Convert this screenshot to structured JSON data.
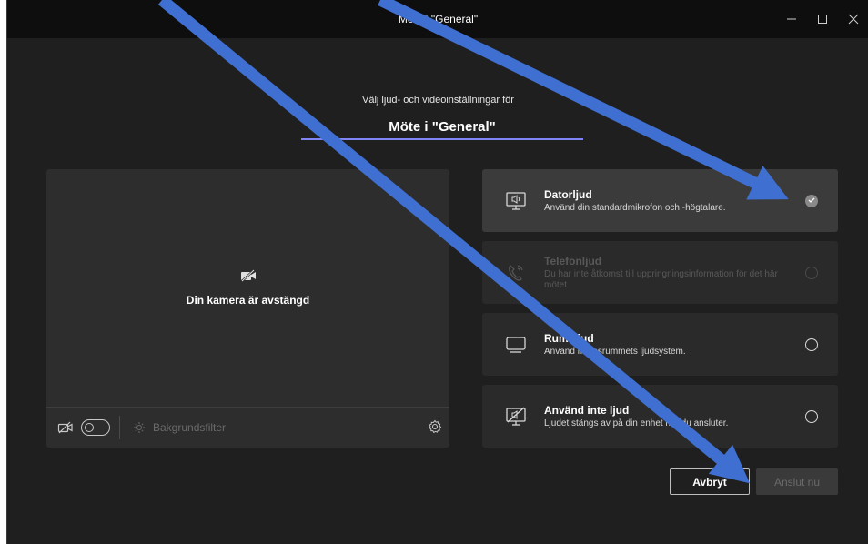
{
  "window": {
    "title": "Möte i \"General\"",
    "controls": [
      "minimize",
      "maximize",
      "close"
    ]
  },
  "prompt": "Välj ljud- och videoinställningar för",
  "meeting_name": "Möte i \"General\"",
  "preview": {
    "camera_off_text": "Din kamera är avstängd",
    "background_filter_label": "Bakgrundsfilter"
  },
  "audio_options": [
    {
      "title": "Datorljud",
      "desc": "Använd din standardmikrofon och -högtalare.",
      "state": "selected"
    },
    {
      "title": "Telefonljud",
      "desc": "Du har inte åtkomst till uppringningsinformation för det här mötet",
      "state": "disabled"
    },
    {
      "title": "Rumsljud",
      "desc": "Använd mötesrummets ljudsystem.",
      "state": "unselected"
    },
    {
      "title": "Använd inte ljud",
      "desc": "Ljudet stängs av på din enhet när du ansluter.",
      "state": "unselected"
    }
  ],
  "buttons": {
    "cancel": "Avbryt",
    "join": "Anslut nu"
  },
  "colors": {
    "accent": "#7f85f5",
    "annotation_arrow": "#3f6fd1"
  }
}
